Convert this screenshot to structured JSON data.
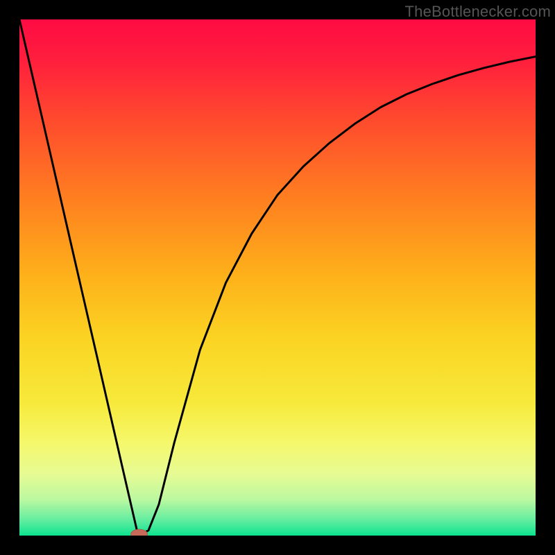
{
  "watermark": "TheBottlenecker.com",
  "chart_data": {
    "type": "line",
    "title": "",
    "xlabel": "",
    "ylabel": "",
    "xlim": [
      0,
      100
    ],
    "ylim": [
      0,
      100
    ],
    "background_gradient": {
      "stops": [
        {
          "offset": 0.0,
          "color": "#ff0b43"
        },
        {
          "offset": 0.08,
          "color": "#ff1f3d"
        },
        {
          "offset": 0.2,
          "color": "#ff4c2d"
        },
        {
          "offset": 0.35,
          "color": "#ff8020"
        },
        {
          "offset": 0.5,
          "color": "#fdb21a"
        },
        {
          "offset": 0.62,
          "color": "#fbd423"
        },
        {
          "offset": 0.74,
          "color": "#f7e93a"
        },
        {
          "offset": 0.82,
          "color": "#f5f86b"
        },
        {
          "offset": 0.88,
          "color": "#e7fb93"
        },
        {
          "offset": 0.93,
          "color": "#bcf8a0"
        },
        {
          "offset": 0.97,
          "color": "#62eda0"
        },
        {
          "offset": 1.0,
          "color": "#0de38f"
        }
      ]
    },
    "series": [
      {
        "name": "bottleneck-curve",
        "x": [
          0,
          5,
          10,
          15,
          20,
          23,
          25,
          27,
          30,
          35,
          40,
          45,
          50,
          55,
          60,
          65,
          70,
          75,
          80,
          85,
          90,
          95,
          100
        ],
        "y": [
          100,
          78.3,
          56.5,
          34.8,
          13.0,
          0.0,
          1.0,
          6.0,
          18.0,
          36.0,
          49.0,
          58.5,
          66.0,
          71.5,
          76.0,
          79.8,
          83.0,
          85.5,
          87.5,
          89.2,
          90.6,
          91.8,
          92.8
        ]
      }
    ],
    "marker": {
      "x": 23.2,
      "y": 0.3,
      "rx": 1.6,
      "ry": 0.9
    }
  }
}
